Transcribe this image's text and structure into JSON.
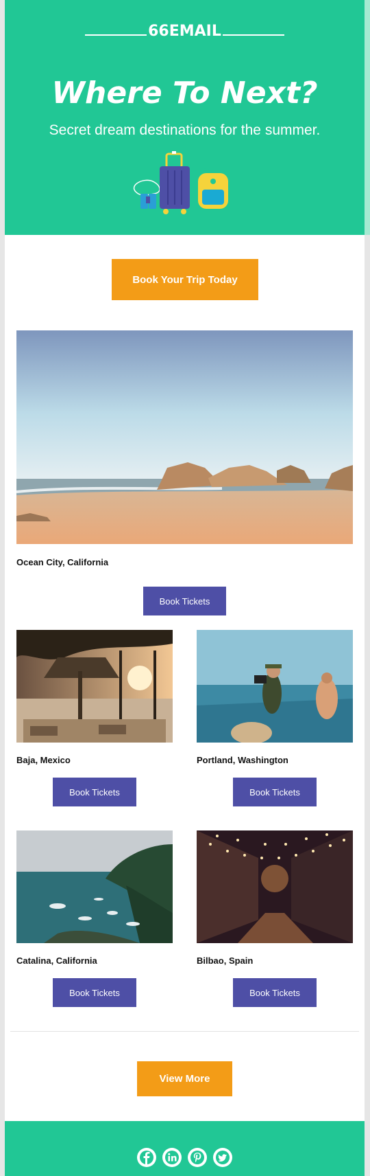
{
  "header": {
    "logo": "66EMAIL",
    "title": "Where To Next?",
    "subtitle": "Secret dream destinations for the summer."
  },
  "cta_top": "Book Your Trip Today",
  "featured": {
    "caption": "Ocean City, California",
    "button": "Book Tickets"
  },
  "destinations": [
    {
      "caption": "Baja, Mexico",
      "button": "Book Tickets"
    },
    {
      "caption": "Portland, Washington",
      "button": "Book Tickets"
    },
    {
      "caption": "Catalina, California",
      "button": "Book Tickets"
    },
    {
      "caption": "Bilbao, Spain",
      "button": "Book Tickets"
    }
  ],
  "cta_bottom": "View More",
  "social": [
    {
      "icon": "facebook-icon"
    },
    {
      "icon": "linkedin-icon"
    },
    {
      "icon": "pinterest-icon"
    },
    {
      "icon": "twitter-icon"
    }
  ],
  "colors": {
    "brand_green": "#21c795",
    "orange": "#f39c17",
    "purple": "#4e4fa6"
  }
}
